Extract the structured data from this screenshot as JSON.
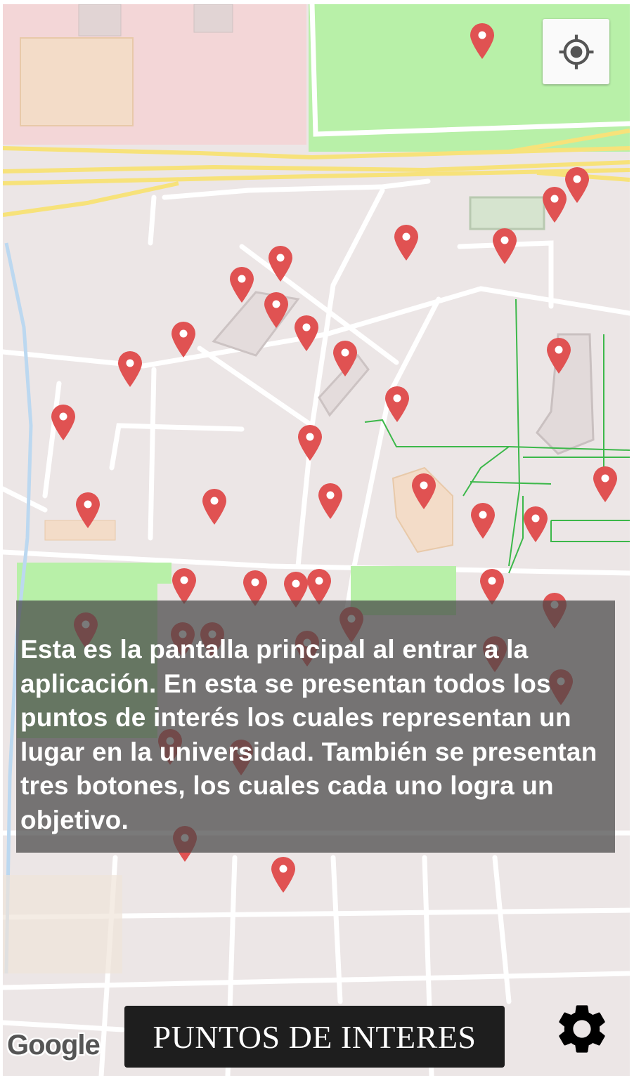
{
  "overlay": {
    "text": "Esta es la pantalla principal al entrar a la aplicación. En esta se presentan todos los puntos de interés los cuales representan un lugar en la universidad. También se presentan tres botones, los cuales cada uno logra un objetivo."
  },
  "buttons": {
    "points_of_interest": "PUNTOS DE INTERES"
  },
  "attribution": {
    "google": "Google"
  },
  "icons": {
    "locate": "my-location-icon",
    "settings": "gear-icon",
    "marker": "map-pin-icon"
  },
  "colors": {
    "marker": "#e05252",
    "marker_dim": "#8e2f2f",
    "park": "#b8f0a8",
    "road_major": "#f7e27a",
    "footpath": "#3cb84a"
  }
}
